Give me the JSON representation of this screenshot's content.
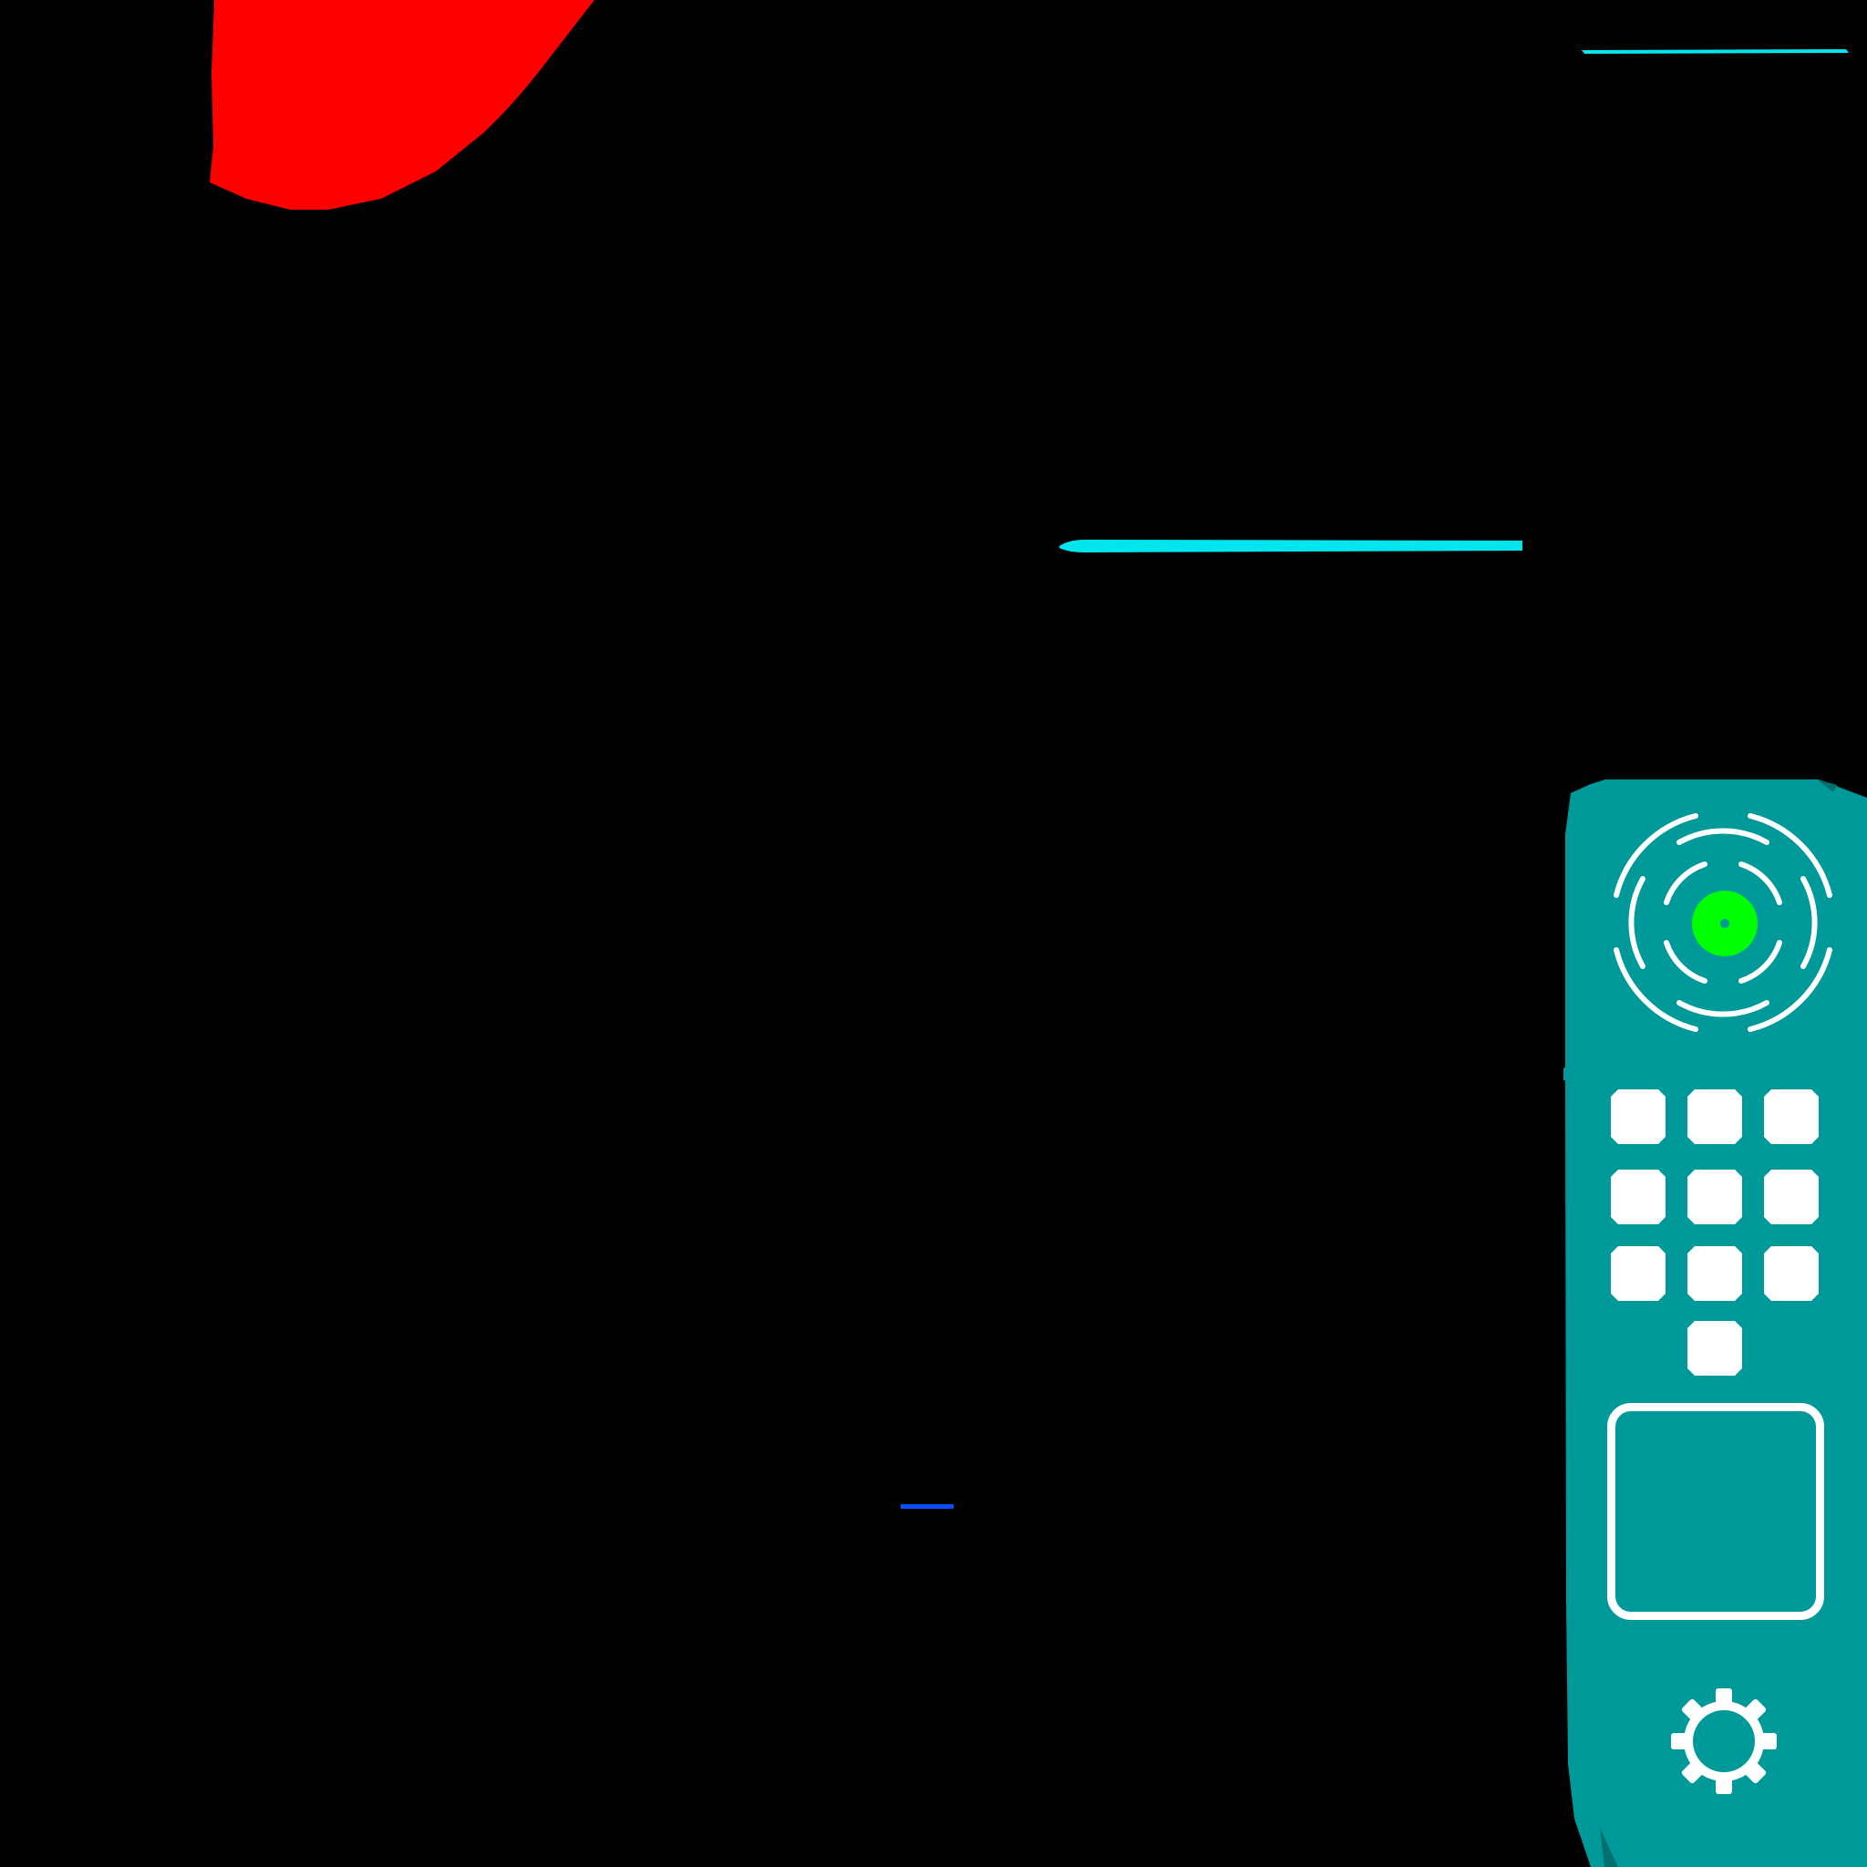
{
  "colors": {
    "background": "#000000",
    "red_shape": "#ff0000",
    "cyan_line": "#00e5ee",
    "blue_line": "#0a4dff",
    "panel": "#009999",
    "panel_dark": "#00716f",
    "joystick_knob": "#00ff00",
    "icon": "#ffffff"
  },
  "controls_panel": {
    "joystick_icon": "target-joystick-icon",
    "keypad": {
      "key_count": 10
    },
    "touchpad_icon": "rounded-square-touchpad-icon",
    "settings_icon": "gear-icon"
  }
}
